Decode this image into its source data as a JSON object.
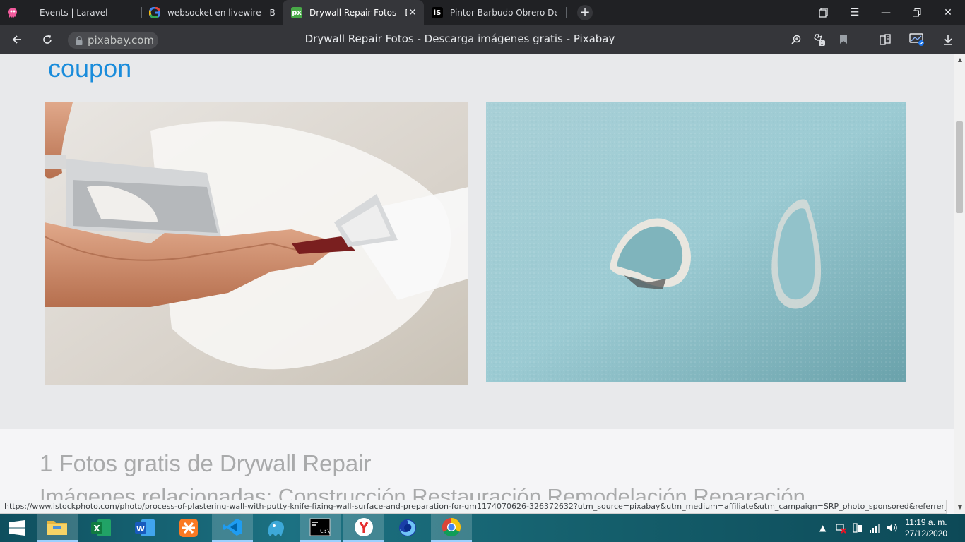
{
  "tabs": [
    {
      "title": "Events | Laravel",
      "favicon": "laravel-icon"
    },
    {
      "title": "websocket en livewire - Bu",
      "favicon": "google-icon"
    },
    {
      "title": "Drywall Repair Fotos - D",
      "favicon": "pixabay-icon",
      "favicon_text": "px",
      "active": true
    },
    {
      "title": "Pintor Barbudo Obrero De",
      "favicon": "istock-icon",
      "favicon_text": "iS"
    }
  ],
  "omnibox": {
    "domain": "pixabay.com"
  },
  "page_title": "Drywall Repair Fotos - Descarga imágenes gratis - Pixabay",
  "page": {
    "coupon_text": "coupon",
    "image1_alt": "process-of-plastering-wall",
    "image2_alt": "drywall-holes",
    "heading": "1 Fotos gratis de Drywall Repair",
    "related": "Imágenes relacionadas:   Construcción  Restauración  Remodelación  Reparación"
  },
  "statusbar_url": "https://www.istockphoto.com/photo/process-of-plastering-wall-with-putty-knife-fixing-wall-surface-and-preparation-for-gm1174070626-326372632?utm_source=pixabay&utm_medium=affiliate&utm_campaign=SRP_photo_sponsored&referrer_url=...",
  "taskbar": {
    "clock_time": "11:19 a. m.",
    "clock_date": "27/12/2020",
    "apps": [
      "start",
      "file-explorer",
      "excel",
      "word",
      "xampp",
      "vscode",
      "tableplus",
      "terminal",
      "yandex",
      "firefox",
      "chrome"
    ]
  },
  "colors": {
    "accent": "#1a8cdb",
    "tab_bg": "#202124",
    "toolbar_bg": "#35363a"
  }
}
